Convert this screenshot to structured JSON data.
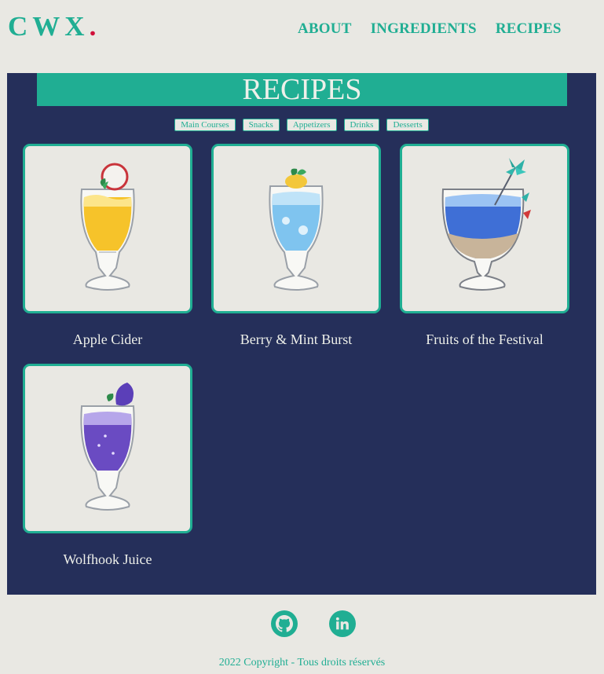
{
  "header": {
    "logo_text": "CWX",
    "logo_dot": ".",
    "nav": [
      "ABOUT",
      "INGREDIENTS",
      "RECIPES"
    ]
  },
  "main": {
    "banner_title": "RECIPES",
    "filters": [
      "Main Courses",
      "Snacks",
      "Appetizers",
      "Drinks",
      "Desserts"
    ],
    "recipes": [
      {
        "name": "Apple Cider",
        "drink_color": "#f6c32a",
        "image": "apple-cider-drink"
      },
      {
        "name": "Berry & Mint Burst",
        "drink_color": "#7fc4ef",
        "image": "berry-mint-drink"
      },
      {
        "name": "Fruits of the Festival",
        "drink_color": "#3f6fd6",
        "image": "festival-drink"
      },
      {
        "name": "Wolfhook Juice",
        "drink_color": "#6a4bc2",
        "image": "wolfhook-drink"
      }
    ]
  },
  "footer": {
    "icons": [
      "github-icon",
      "linkedin-icon"
    ],
    "copyright": "2022 Copyright - Tous droits réservés"
  },
  "colors": {
    "accent": "#20ae93",
    "panel": "#252f5a",
    "background": "#e9e8e3",
    "logo_dot": "#d0103a"
  }
}
